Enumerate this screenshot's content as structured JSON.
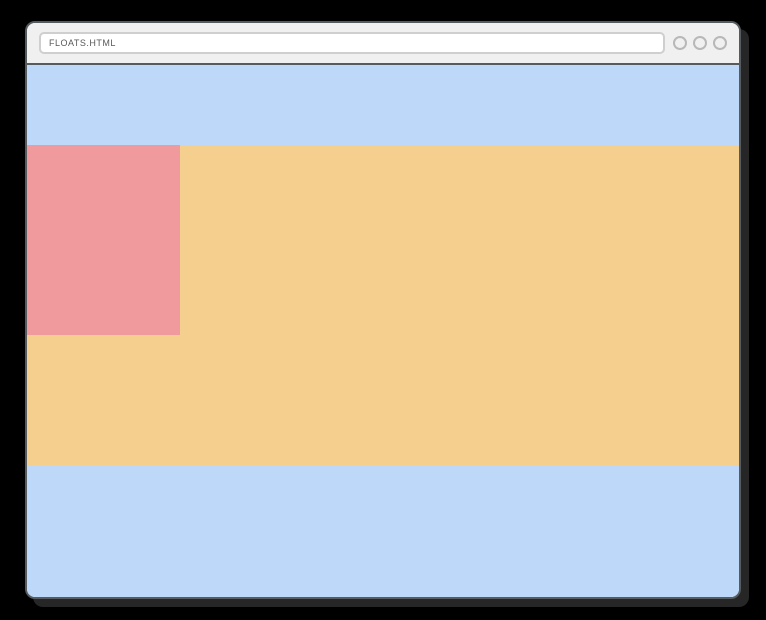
{
  "titlebar": {
    "address": "FLOATS.HTML"
  },
  "colors": {
    "page_bg": "#bdd8f8",
    "content_bg": "#f5cf8e",
    "float_bg": "#f09a9d"
  }
}
